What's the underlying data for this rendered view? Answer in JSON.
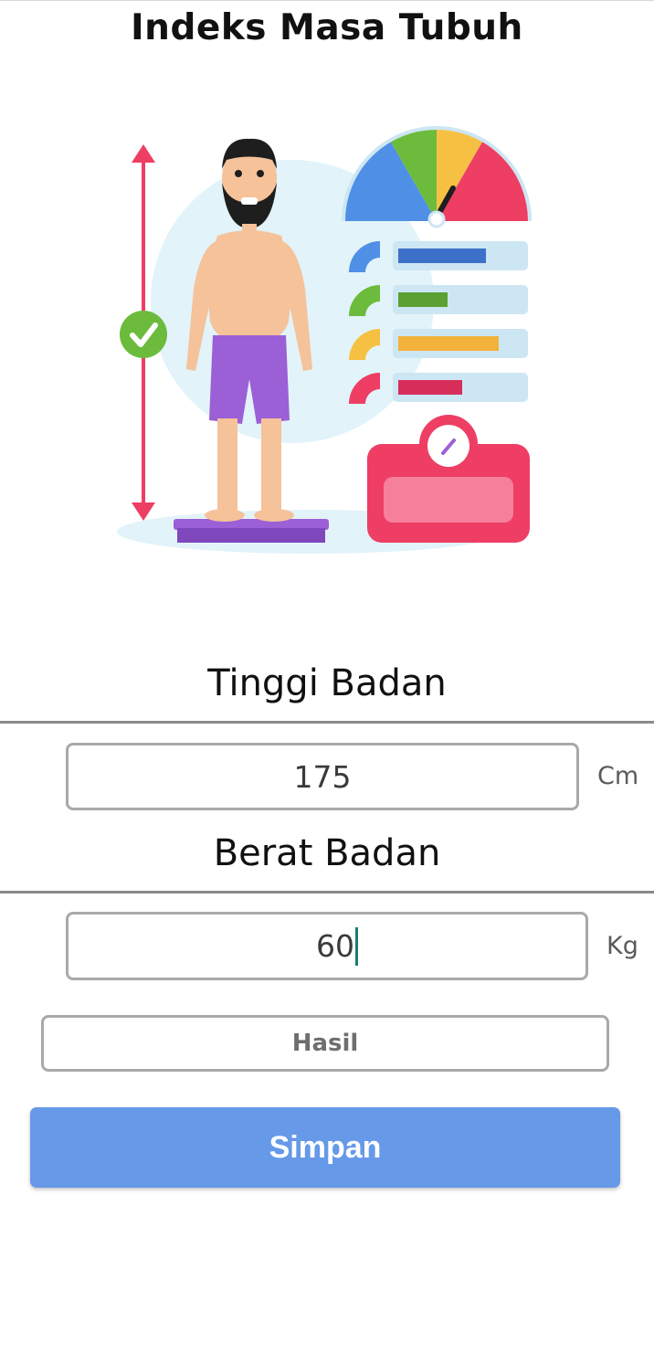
{
  "header": {
    "title": "Indeks Masa Tubuh"
  },
  "illustration": {
    "icon": "bmi-illustration-icon",
    "accent_colors": {
      "blue": "#4f8fe6",
      "green": "#6cbb3c",
      "yellow": "#f6c142",
      "red": "#ee3e64",
      "purple": "#9b5fd6"
    }
  },
  "height_section": {
    "label": "Tinggi Badan",
    "value": "175",
    "unit": "Cm"
  },
  "weight_section": {
    "label": "Berat Badan",
    "value": "60",
    "unit": "Kg"
  },
  "result": {
    "placeholder": "Hasil"
  },
  "actions": {
    "save_label": "Simpan",
    "color": "#6699e8"
  }
}
